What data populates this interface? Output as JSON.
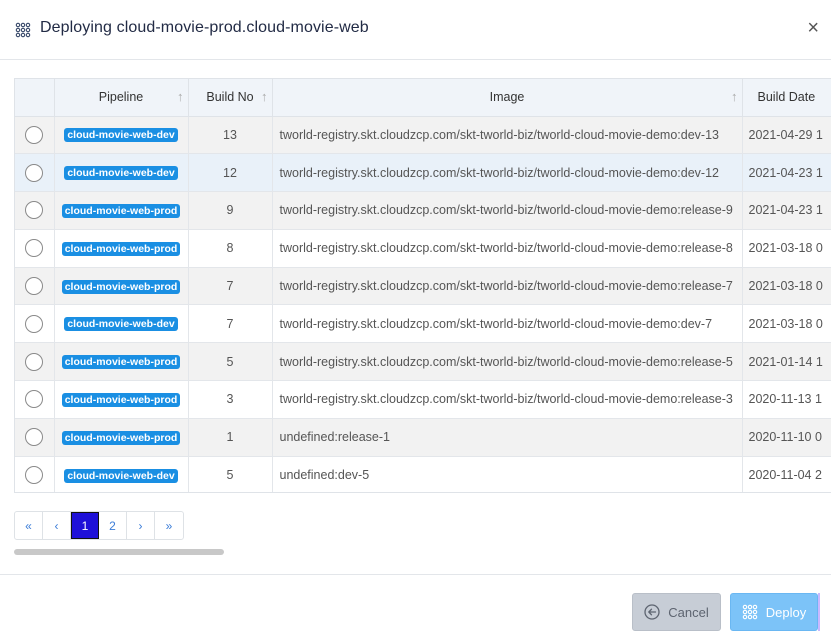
{
  "modal": {
    "title": "Deploying cloud-movie-prod.cloud-movie-web",
    "close_glyph": "×"
  },
  "table": {
    "columns": [
      "Pipeline",
      "Build No",
      "Image",
      "Build Date"
    ],
    "rows": [
      {
        "pipeline": "cloud-movie-web-dev",
        "build_no": "13",
        "image": "tworld-registry.skt.cloudzcp.com/skt-tworld-biz/tworld-cloud-movie-demo:dev-13",
        "build_date": "2021-04-29 1"
      },
      {
        "pipeline": "cloud-movie-web-dev",
        "build_no": "12",
        "image": "tworld-registry.skt.cloudzcp.com/skt-tworld-biz/tworld-cloud-movie-demo:dev-12",
        "build_date": "2021-04-23 1"
      },
      {
        "pipeline": "cloud-movie-web-prod",
        "build_no": "9",
        "image": "tworld-registry.skt.cloudzcp.com/skt-tworld-biz/tworld-cloud-movie-demo:release-9",
        "build_date": "2021-04-23 1"
      },
      {
        "pipeline": "cloud-movie-web-prod",
        "build_no": "8",
        "image": "tworld-registry.skt.cloudzcp.com/skt-tworld-biz/tworld-cloud-movie-demo:release-8",
        "build_date": "2021-03-18 0"
      },
      {
        "pipeline": "cloud-movie-web-prod",
        "build_no": "7",
        "image": "tworld-registry.skt.cloudzcp.com/skt-tworld-biz/tworld-cloud-movie-demo:release-7",
        "build_date": "2021-03-18 0"
      },
      {
        "pipeline": "cloud-movie-web-dev",
        "build_no": "7",
        "image": "tworld-registry.skt.cloudzcp.com/skt-tworld-biz/tworld-cloud-movie-demo:dev-7",
        "build_date": "2021-03-18 0"
      },
      {
        "pipeline": "cloud-movie-web-prod",
        "build_no": "5",
        "image": "tworld-registry.skt.cloudzcp.com/skt-tworld-biz/tworld-cloud-movie-demo:release-5",
        "build_date": "2021-01-14 1"
      },
      {
        "pipeline": "cloud-movie-web-prod",
        "build_no": "3",
        "image": "tworld-registry.skt.cloudzcp.com/skt-tworld-biz/tworld-cloud-movie-demo:release-3",
        "build_date": "2020-11-13 1"
      },
      {
        "pipeline": "cloud-movie-web-prod",
        "build_no": "1",
        "image": "undefined:release-1",
        "build_date": "2020-11-10 0"
      },
      {
        "pipeline": "cloud-movie-web-dev",
        "build_no": "5",
        "image": "undefined:dev-5",
        "build_date": "2020-11-04 2"
      }
    ]
  },
  "pagination": {
    "first": "«",
    "prev": "‹",
    "pages": [
      "1",
      "2"
    ],
    "active_page": "1",
    "next": "›",
    "last": "»"
  },
  "footer": {
    "cancel_label": "Cancel",
    "deploy_label": "Deploy"
  },
  "colors": {
    "badge": "#1a8fe3",
    "active_page": "#1e10d8",
    "deploy_button": "#7cc3f8",
    "cancel_button": "#c7cdd6"
  },
  "icons": {
    "title": "grid-dots-icon",
    "close": "close-icon",
    "sort": "sort-arrow-icon",
    "cancel": "circle-arrow-left-icon",
    "deploy": "grid-dots-icon"
  }
}
